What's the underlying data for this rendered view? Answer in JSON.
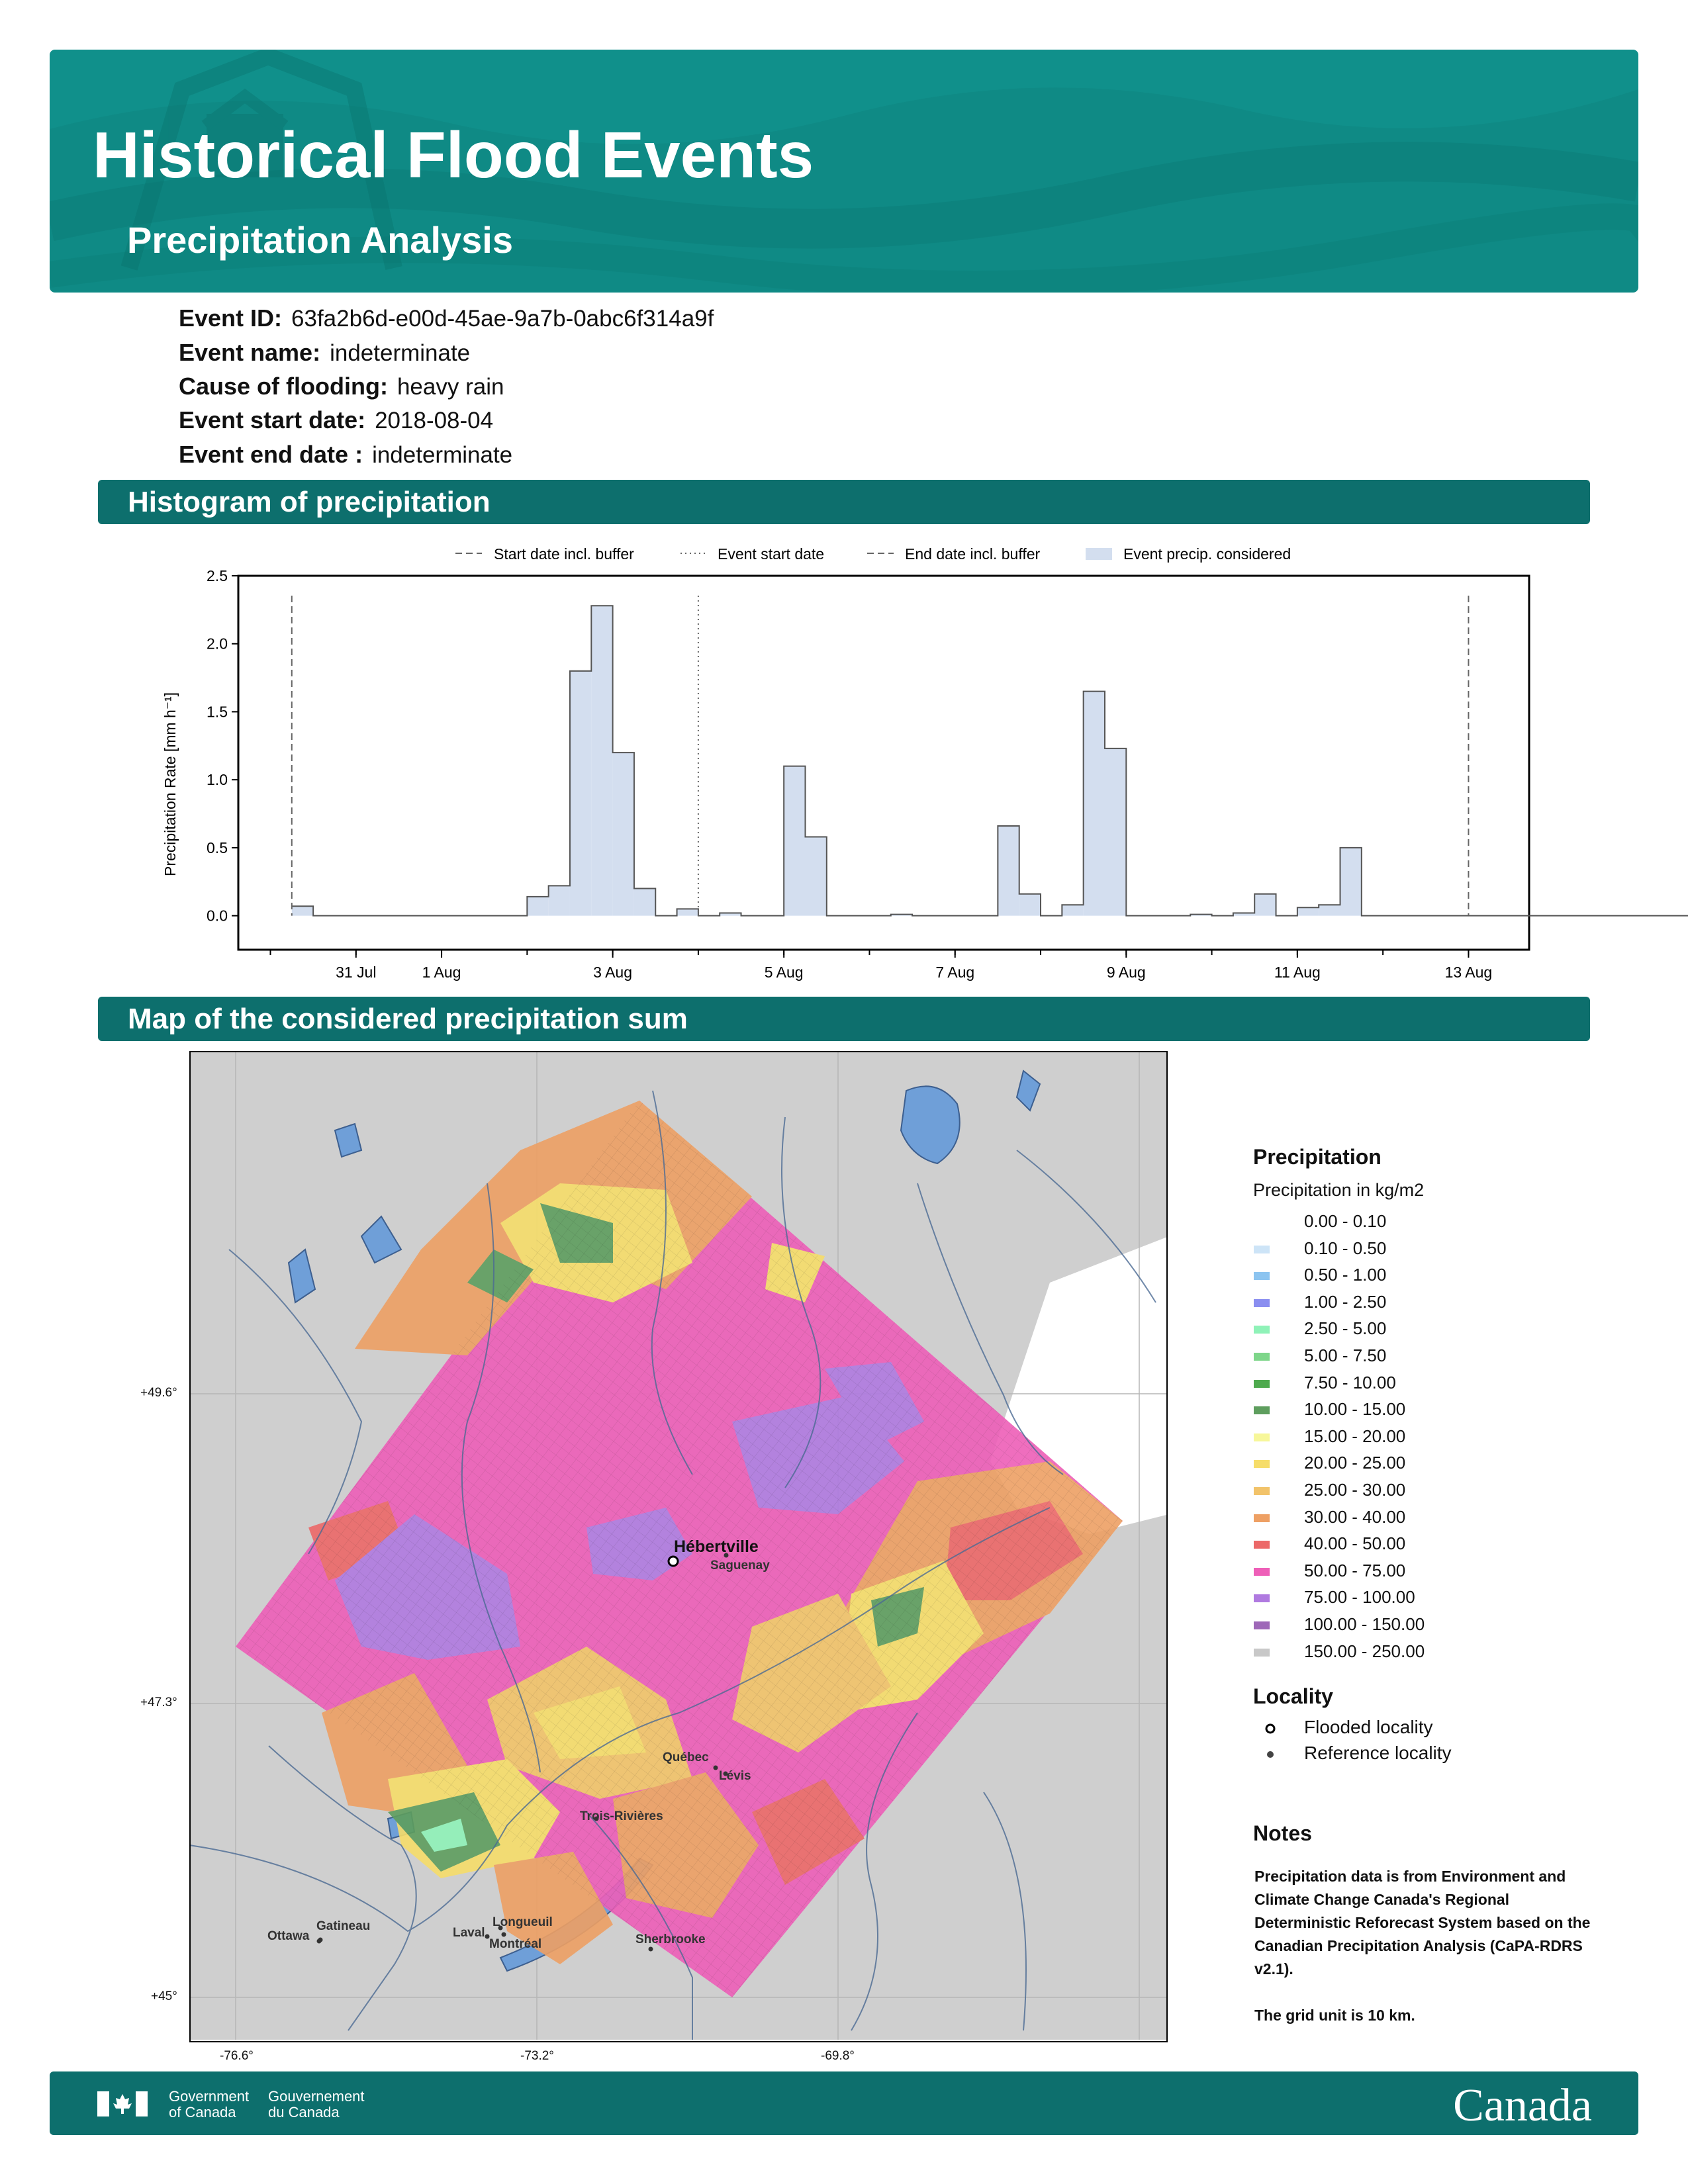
{
  "header": {
    "title": "Historical Flood Events",
    "subtitle": "Precipitation Analysis"
  },
  "event_info": [
    {
      "label": "Event ID:",
      "value": "63fa2b6d-e00d-45ae-9a7b-0abc6f314a9f"
    },
    {
      "label": "Event name:",
      "value": "indeterminate"
    },
    {
      "label": "Cause of flooding:",
      "value": "heavy rain"
    },
    {
      "label": "Event start date:",
      "value": "2018-08-04"
    },
    {
      "label": "Event end date :",
      "value": "indeterminate"
    }
  ],
  "sections": {
    "histogram": "Histogram of precipitation",
    "map": "Map of the considered precipitation sum"
  },
  "chart_legend": [
    "Start date incl. buffer",
    "Event start date",
    "End date incl. buffer",
    "Event precip. considered"
  ],
  "chart_data": {
    "type": "bar",
    "title": "",
    "xlabel": "",
    "ylabel": "Precipitation Rate [mm h⁻¹]",
    "ylim": [
      -0.25,
      2.5
    ],
    "yticks": [
      "0.0",
      "0.5",
      "1.0",
      "1.5",
      "2.0",
      "2.5"
    ],
    "xticks": [
      {
        "date": "2018-07-31",
        "label": "31 Jul"
      },
      {
        "date": "2018-08-01",
        "label": "1 Aug"
      },
      {
        "date": "2018-08-03",
        "label": "3 Aug"
      },
      {
        "date": "2018-08-05",
        "label": "5 Aug"
      },
      {
        "date": "2018-08-07",
        "label": "7 Aug"
      },
      {
        "date": "2018-08-09",
        "label": "9 Aug"
      },
      {
        "date": "2018-08-11",
        "label": "11 Aug"
      },
      {
        "date": "2018-08-13",
        "label": "13 Aug"
      }
    ],
    "bin_width_hours": 6,
    "x_start": "2018-07-30 06:00",
    "start_buffer_date": "2018-07-30 06:00",
    "event_start_date": "2018-08-04 00:00",
    "end_buffer_date": "2018-08-13 00:00",
    "values": [
      0.07,
      0.0,
      0.0,
      0.0,
      0.0,
      0.0,
      0.0,
      0.0,
      0.0,
      0.0,
      0.0,
      0.14,
      0.22,
      1.8,
      2.28,
      1.2,
      0.2,
      0.0,
      0.05,
      0.0,
      0.02,
      0.0,
      0.0,
      1.1,
      0.58,
      0.0,
      0.0,
      0.0,
      0.01,
      0.0,
      0.0,
      0.0,
      0.0,
      0.66,
      0.16,
      0.0,
      0.08,
      1.65,
      1.23,
      0.0,
      0.0,
      0.0,
      0.01,
      0.0,
      0.02,
      0.16,
      0.0,
      0.06,
      0.08,
      0.5,
      0.0,
      0.0,
      0.0,
      0.0,
      0.0,
      0.0,
      0.0,
      0.0,
      0.0,
      0.0,
      0.0,
      0.0,
      0.0,
      0.0,
      0.0,
      0.0,
      0.0,
      0.0,
      0.0,
      0.0,
      0.0
    ]
  },
  "map": {
    "lat_labels": [
      "+49.6°",
      "+47.3°",
      "+45°"
    ],
    "lon_labels": [
      "-76.6°",
      "-73.2°",
      "-69.8°"
    ],
    "flooded_localities": [
      "Hébertville"
    ],
    "reference_localities": [
      "Saguenay",
      "Québec",
      "Lévis",
      "Trois-Rivières",
      "Longueuil",
      "Montréal",
      "Laval",
      "Gatineau",
      "Ottawa",
      "Sherbrooke"
    ]
  },
  "precip_legend": {
    "title": "Precipitation",
    "subtitle": "Precipitation in kg/m2",
    "classes": [
      {
        "label": "0.00 - 0.10",
        "color": "#ffffff"
      },
      {
        "label": "0.10 - 0.50",
        "color": "#cde4f7"
      },
      {
        "label": "0.50 - 1.00",
        "color": "#8cc4f0"
      },
      {
        "label": "1.00 - 2.50",
        "color": "#8a8ef0"
      },
      {
        "label": "2.50 - 5.00",
        "color": "#8ff2b8"
      },
      {
        "label": "5.00 - 7.50",
        "color": "#7ed68a"
      },
      {
        "label": "7.50 - 10.00",
        "color": "#4eaa4e"
      },
      {
        "label": "10.00 - 15.00",
        "color": "#5e9e5e"
      },
      {
        "label": "15.00 - 20.00",
        "color": "#f7f79a"
      },
      {
        "label": "20.00 - 25.00",
        "color": "#f6dd6a"
      },
      {
        "label": "25.00 - 30.00",
        "color": "#f2c36a"
      },
      {
        "label": "30.00 - 40.00",
        "color": "#eea064"
      },
      {
        "label": "40.00 - 50.00",
        "color": "#ec6868"
      },
      {
        "label": "50.00 - 75.00",
        "color": "#ee5fb8"
      },
      {
        "label": "75.00 - 100.00",
        "color": "#b07ae0"
      },
      {
        "label": "100.00 - 150.00",
        "color": "#9e68b8"
      },
      {
        "label": "150.00 - 250.00",
        "color": "#c8c8c8"
      }
    ]
  },
  "locality_legend": {
    "title": "Locality",
    "flooded": "Flooded locality",
    "reference": "Reference locality"
  },
  "notes": {
    "title": "Notes",
    "body": "Precipitation data is from Environment and Climate Change Canada's Regional Deterministic Reforecast System based on the Canadian Precipitation Analysis (CaPA-RDRS v2.1).",
    "grid": "The grid unit is 10 km."
  },
  "footer": {
    "gov_en_1": "Government",
    "gov_en_2": "of Canada",
    "gov_fr_1": "Gouvernement",
    "gov_fr_2": "du Canada",
    "wordmark": "Canada"
  }
}
